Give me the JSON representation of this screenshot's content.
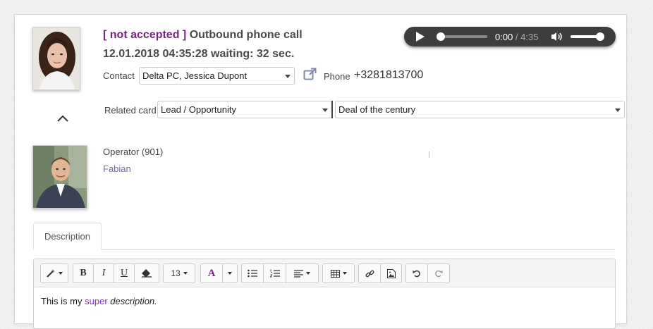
{
  "call": {
    "status_text": "[ not accepted ]",
    "title": "Outbound phone call",
    "datetime_line": "12.01.2018 04:35:28 waiting: 32 sec."
  },
  "player": {
    "current_time": "0:00",
    "separator": " / ",
    "duration": "4:35",
    "progress": 0,
    "volume": 0.85
  },
  "contact": {
    "label": "Contact",
    "value": "Delta PC, Jessica Dupont",
    "phone_label": "Phone",
    "phone": "+3281813700"
  },
  "related": {
    "label": "Related card",
    "type_value": "Lead / Opportunity",
    "card_value": "Deal of the century"
  },
  "operator": {
    "label": "Operator (901)",
    "name": "Fabian"
  },
  "tabs": [
    {
      "label": "Description"
    }
  ],
  "toolbar": {
    "font_size": "13",
    "bold": "B",
    "italic": "I",
    "underline": "U",
    "font_color": "A"
  },
  "description": {
    "before": "This is my ",
    "highlight": "super",
    "space": " ",
    "italic": "description."
  },
  "colors": {
    "accent": "#7c2289",
    "link": "#6a6fa8",
    "player_bg": "#3d3d3d"
  }
}
